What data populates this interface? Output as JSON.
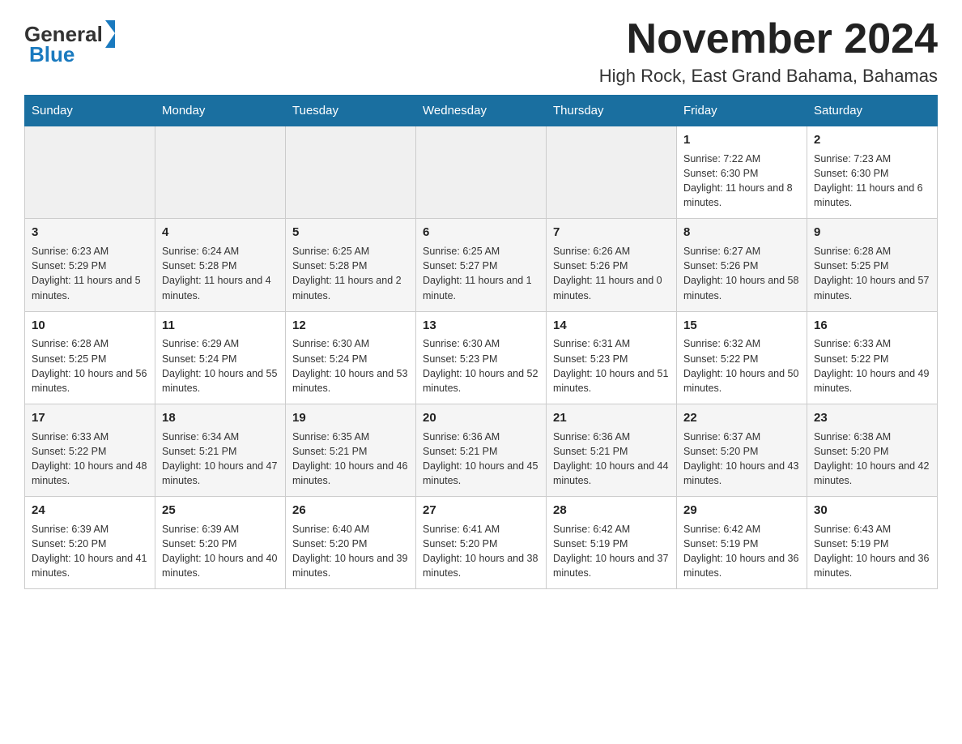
{
  "header": {
    "logo_general": "General",
    "logo_blue": "Blue",
    "month_title": "November 2024",
    "location": "High Rock, East Grand Bahama, Bahamas"
  },
  "weekdays": [
    "Sunday",
    "Monday",
    "Tuesday",
    "Wednesday",
    "Thursday",
    "Friday",
    "Saturday"
  ],
  "weeks": [
    [
      {
        "day": "",
        "info": ""
      },
      {
        "day": "",
        "info": ""
      },
      {
        "day": "",
        "info": ""
      },
      {
        "day": "",
        "info": ""
      },
      {
        "day": "",
        "info": ""
      },
      {
        "day": "1",
        "info": "Sunrise: 7:22 AM\nSunset: 6:30 PM\nDaylight: 11 hours and 8 minutes."
      },
      {
        "day": "2",
        "info": "Sunrise: 7:23 AM\nSunset: 6:30 PM\nDaylight: 11 hours and 6 minutes."
      }
    ],
    [
      {
        "day": "3",
        "info": "Sunrise: 6:23 AM\nSunset: 5:29 PM\nDaylight: 11 hours and 5 minutes."
      },
      {
        "day": "4",
        "info": "Sunrise: 6:24 AM\nSunset: 5:28 PM\nDaylight: 11 hours and 4 minutes."
      },
      {
        "day": "5",
        "info": "Sunrise: 6:25 AM\nSunset: 5:28 PM\nDaylight: 11 hours and 2 minutes."
      },
      {
        "day": "6",
        "info": "Sunrise: 6:25 AM\nSunset: 5:27 PM\nDaylight: 11 hours and 1 minute."
      },
      {
        "day": "7",
        "info": "Sunrise: 6:26 AM\nSunset: 5:26 PM\nDaylight: 11 hours and 0 minutes."
      },
      {
        "day": "8",
        "info": "Sunrise: 6:27 AM\nSunset: 5:26 PM\nDaylight: 10 hours and 58 minutes."
      },
      {
        "day": "9",
        "info": "Sunrise: 6:28 AM\nSunset: 5:25 PM\nDaylight: 10 hours and 57 minutes."
      }
    ],
    [
      {
        "day": "10",
        "info": "Sunrise: 6:28 AM\nSunset: 5:25 PM\nDaylight: 10 hours and 56 minutes."
      },
      {
        "day": "11",
        "info": "Sunrise: 6:29 AM\nSunset: 5:24 PM\nDaylight: 10 hours and 55 minutes."
      },
      {
        "day": "12",
        "info": "Sunrise: 6:30 AM\nSunset: 5:24 PM\nDaylight: 10 hours and 53 minutes."
      },
      {
        "day": "13",
        "info": "Sunrise: 6:30 AM\nSunset: 5:23 PM\nDaylight: 10 hours and 52 minutes."
      },
      {
        "day": "14",
        "info": "Sunrise: 6:31 AM\nSunset: 5:23 PM\nDaylight: 10 hours and 51 minutes."
      },
      {
        "day": "15",
        "info": "Sunrise: 6:32 AM\nSunset: 5:22 PM\nDaylight: 10 hours and 50 minutes."
      },
      {
        "day": "16",
        "info": "Sunrise: 6:33 AM\nSunset: 5:22 PM\nDaylight: 10 hours and 49 minutes."
      }
    ],
    [
      {
        "day": "17",
        "info": "Sunrise: 6:33 AM\nSunset: 5:22 PM\nDaylight: 10 hours and 48 minutes."
      },
      {
        "day": "18",
        "info": "Sunrise: 6:34 AM\nSunset: 5:21 PM\nDaylight: 10 hours and 47 minutes."
      },
      {
        "day": "19",
        "info": "Sunrise: 6:35 AM\nSunset: 5:21 PM\nDaylight: 10 hours and 46 minutes."
      },
      {
        "day": "20",
        "info": "Sunrise: 6:36 AM\nSunset: 5:21 PM\nDaylight: 10 hours and 45 minutes."
      },
      {
        "day": "21",
        "info": "Sunrise: 6:36 AM\nSunset: 5:21 PM\nDaylight: 10 hours and 44 minutes."
      },
      {
        "day": "22",
        "info": "Sunrise: 6:37 AM\nSunset: 5:20 PM\nDaylight: 10 hours and 43 minutes."
      },
      {
        "day": "23",
        "info": "Sunrise: 6:38 AM\nSunset: 5:20 PM\nDaylight: 10 hours and 42 minutes."
      }
    ],
    [
      {
        "day": "24",
        "info": "Sunrise: 6:39 AM\nSunset: 5:20 PM\nDaylight: 10 hours and 41 minutes."
      },
      {
        "day": "25",
        "info": "Sunrise: 6:39 AM\nSunset: 5:20 PM\nDaylight: 10 hours and 40 minutes."
      },
      {
        "day": "26",
        "info": "Sunrise: 6:40 AM\nSunset: 5:20 PM\nDaylight: 10 hours and 39 minutes."
      },
      {
        "day": "27",
        "info": "Sunrise: 6:41 AM\nSunset: 5:20 PM\nDaylight: 10 hours and 38 minutes."
      },
      {
        "day": "28",
        "info": "Sunrise: 6:42 AM\nSunset: 5:19 PM\nDaylight: 10 hours and 37 minutes."
      },
      {
        "day": "29",
        "info": "Sunrise: 6:42 AM\nSunset: 5:19 PM\nDaylight: 10 hours and 36 minutes."
      },
      {
        "day": "30",
        "info": "Sunrise: 6:43 AM\nSunset: 5:19 PM\nDaylight: 10 hours and 36 minutes."
      }
    ]
  ]
}
